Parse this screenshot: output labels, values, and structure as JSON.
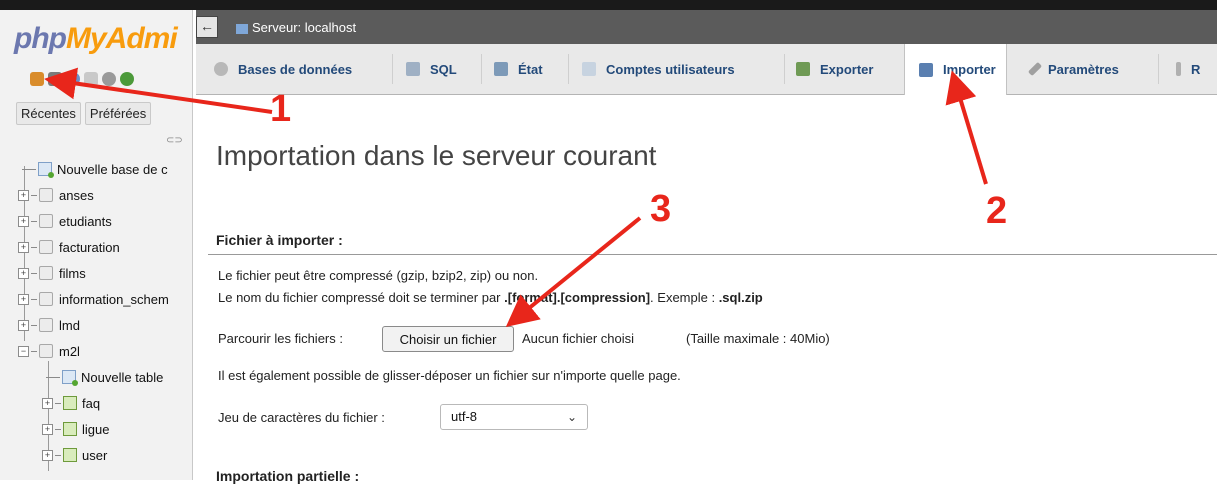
{
  "sidebar": {
    "logo_php": "php",
    "logo_my": "MyAdmi",
    "tabs": [
      "Récentes",
      "Préférées"
    ],
    "tree": [
      {
        "label": "Nouvelle base de c"
      },
      {
        "label": "anses"
      },
      {
        "label": "etudiants"
      },
      {
        "label": "facturation"
      },
      {
        "label": "films"
      },
      {
        "label": "information_schem"
      },
      {
        "label": "lmd"
      },
      {
        "label": "m2l"
      },
      {
        "label": "Nouvelle table"
      },
      {
        "label": "faq"
      },
      {
        "label": "ligue"
      },
      {
        "label": "user"
      }
    ]
  },
  "topbar": {
    "nav_icon": "←",
    "server_label": "Serveur: localhost"
  },
  "menu": [
    {
      "label": "Bases de données"
    },
    {
      "label": "SQL"
    },
    {
      "label": "État"
    },
    {
      "label": "Comptes utilisateurs"
    },
    {
      "label": "Exporter"
    },
    {
      "label": "Importer"
    },
    {
      "label": "Paramètres"
    },
    {
      "label": "R"
    }
  ],
  "main": {
    "title": "Importation dans le serveur courant",
    "file_heading": "Fichier à importer :",
    "compress_line1": "Le fichier peut être compressé (gzip, bzip2, zip) ou non.",
    "compress_line2_a": "Le nom du fichier compressé doit se terminer par ",
    "compress_line2_b": ".[format].[compression]",
    "compress_line2_c": ". Exemple : ",
    "compress_line2_d": ".sql.zip",
    "browse_label": "Parcourir les fichiers :",
    "choose_button": "Choisir un fichier",
    "no_file": "Aucun fichier choisi",
    "max_size": "(Taille maximale : 40Mio)",
    "dragdrop": "Il est également possible de glisser-déposer un fichier sur n'importe quelle page.",
    "charset_label": "Jeu de caractères du fichier :",
    "charset_value": "utf-8",
    "partial_heading": "Importation partielle :"
  },
  "annotations": [
    "1",
    "2",
    "3"
  ],
  "colors": {
    "annotation": "#e8261b",
    "menu_text": "#234a7a"
  }
}
